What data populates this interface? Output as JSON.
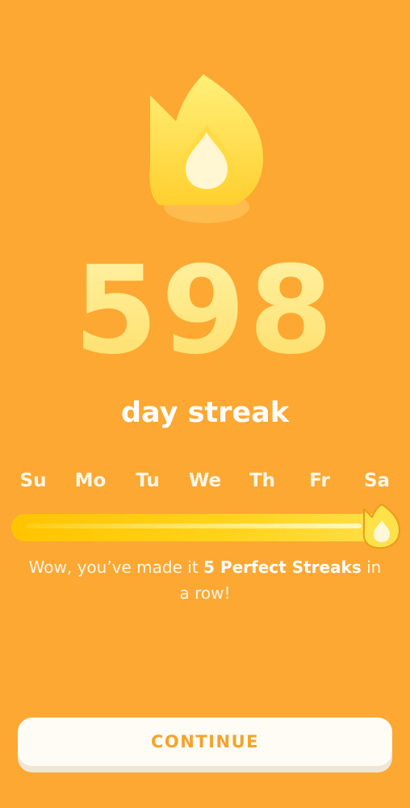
{
  "streak": {
    "count": "598",
    "label": "day streak"
  },
  "week": {
    "days": [
      "Su",
      "Mo",
      "Tu",
      "We",
      "Th",
      "Fr",
      "Sa"
    ],
    "completed_fraction": 1.0,
    "current_day": "Sa"
  },
  "message": {
    "prefix": "Wow, you’ve made it ",
    "highlight": "5 Perfect Streaks",
    "suffix": " in a row!"
  },
  "actions": {
    "continue_label": "CONTINUE"
  },
  "icons": {
    "hero": "flame-icon",
    "progress_marker": "flame-icon"
  },
  "colors": {
    "background": "#FDA833",
    "flame_yellow": "#FFD94A",
    "number": "#FFEB8F",
    "progress_fill": "#FFC400",
    "button_text": "#F5A32C"
  }
}
